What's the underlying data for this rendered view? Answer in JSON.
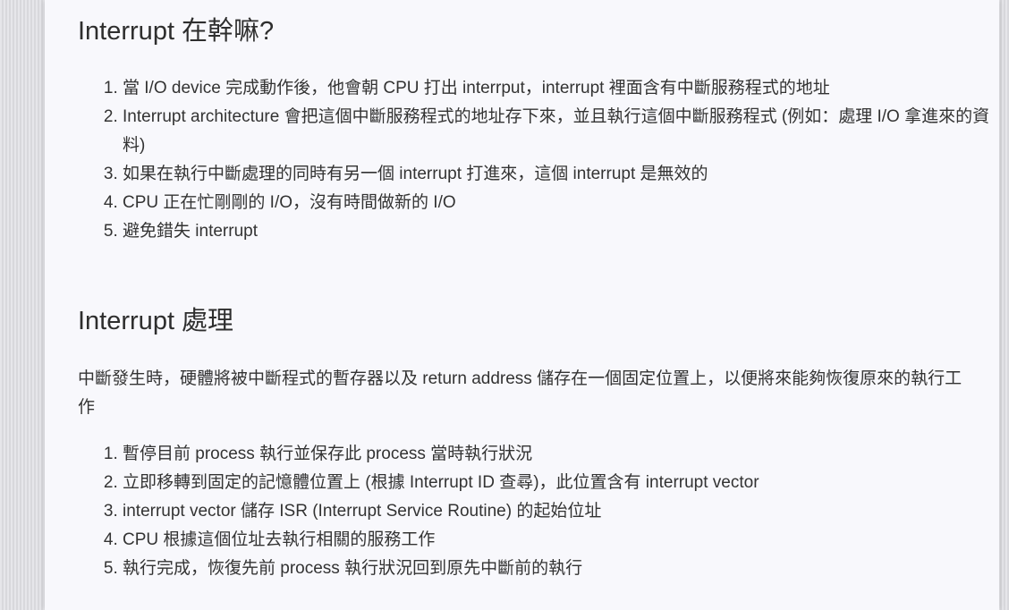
{
  "section1": {
    "heading": "Interrupt 在幹嘛?",
    "items": [
      "當 I/O device 完成動作後，他會朝 CPU 打出 interrput，interrupt 裡面含有中斷服務程式的地址",
      "Interrupt architecture 會把這個中斷服務程式的地址存下來，並且執行這個中斷服務程式 (例如：處理 I/O 拿進來的資料)",
      "如果在執行中斷處理的同時有另一個 interrupt 打進來，這個 interrupt 是無效的",
      "CPU 正在忙剛剛的 I/O，沒有時間做新的 I/O",
      "避免錯失 interrupt"
    ]
  },
  "section2": {
    "heading": "Interrupt 處理",
    "paragraph": "中斷發生時，硬體將被中斷程式的暫存器以及 return address 儲存在一個固定位置上，以便將來能夠恢復原來的執行工作",
    "items": [
      "暫停目前 process 執行並保存此 process 當時執行狀況",
      "立即移轉到固定的記憶體位置上 (根據 Interrupt ID 查尋)，此位置含有 interrupt vector",
      "interrupt vector 儲存 ISR (Interrupt Service Routine) 的起始位址",
      "CPU 根據這個位址去執行相關的服務工作",
      "執行完成，恢復先前 process 執行狀況回到原先中斷前的執行"
    ]
  }
}
